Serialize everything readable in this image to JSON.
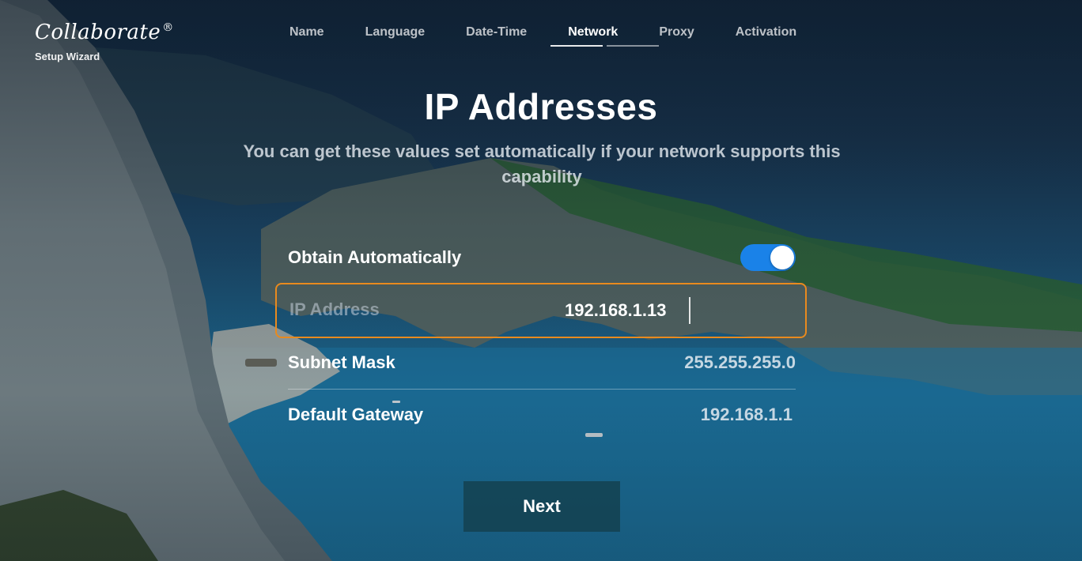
{
  "brand": {
    "logo": "Collaborate",
    "registered": "®",
    "subtitle": "Setup Wizard"
  },
  "nav": {
    "tabs": [
      {
        "label": "Name"
      },
      {
        "label": "Language"
      },
      {
        "label": "Date-Time"
      },
      {
        "label": "Network",
        "active": true
      },
      {
        "label": "Proxy"
      },
      {
        "label": "Activation"
      }
    ]
  },
  "main": {
    "title": "IP Addresses",
    "subtitle": "You can get these values set automatically if your network supports this capability",
    "obtain": {
      "label": "Obtain Automatically",
      "enabled": true
    },
    "ip": {
      "label": "IP Address",
      "value": "192.168.1.13"
    },
    "subnet": {
      "label": "Subnet Mask",
      "value": "255.255.255.0"
    },
    "gateway": {
      "label": "Default Gateway",
      "value": "192.168.1.1"
    },
    "next_label": "Next"
  },
  "colors": {
    "accent": "#1a82e8",
    "focus": "#e98a1e"
  }
}
